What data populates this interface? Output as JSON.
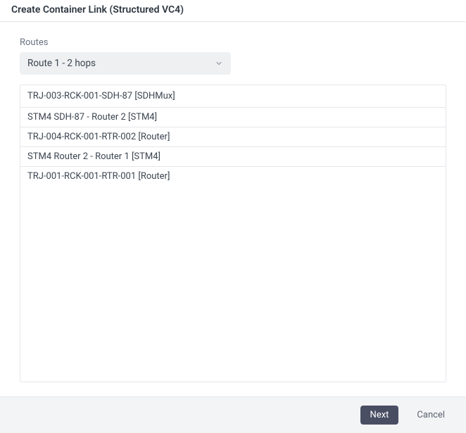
{
  "header": {
    "title": "Create Container Link (Structured VC4)"
  },
  "routes": {
    "label": "Routes",
    "selected": "Route 1 - 2 hops",
    "items": [
      {
        "label": "TRJ-003-RCK-001-SDH-87 [SDHMux]",
        "level": 0
      },
      {
        "label": "STM4 SDH-87 - Router 2 [STM4]",
        "level": 1
      },
      {
        "label": "TRJ-004-RCK-001-RTR-002 [Router]",
        "level": 1
      },
      {
        "label": "STM4 Router 2 - Router 1 [STM4]",
        "level": 1
      },
      {
        "label": "TRJ-001-RCK-001-RTR-001 [Router]",
        "level": 1
      }
    ]
  },
  "footer": {
    "next": "Next",
    "cancel": "Cancel"
  }
}
